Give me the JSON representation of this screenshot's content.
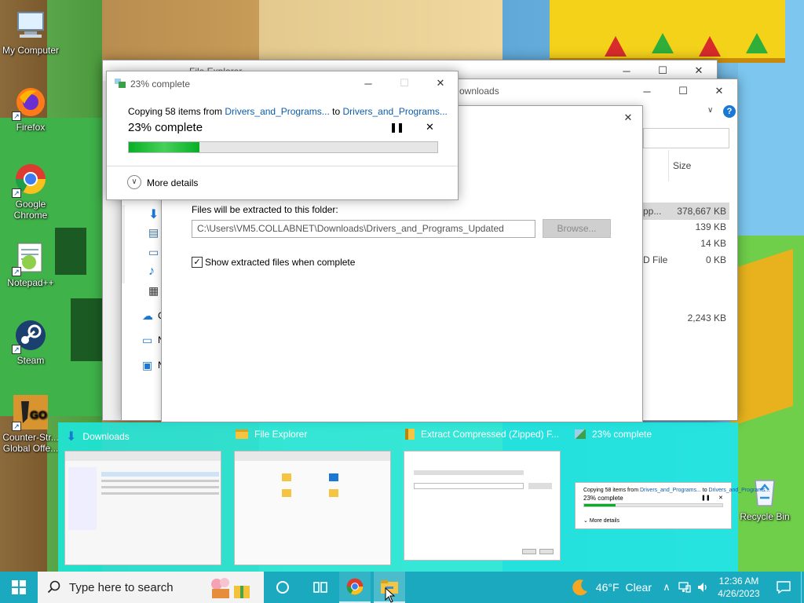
{
  "desktop": {
    "icons": [
      {
        "label": "My Computer",
        "icon": "computer-icon"
      },
      {
        "label": "Firefox",
        "icon": "firefox-icon"
      },
      {
        "label": "Google Chrome",
        "icon": "chrome-icon"
      },
      {
        "label": "Notepad++",
        "icon": "notepad-plus-icon"
      },
      {
        "label": "Steam",
        "icon": "steam-icon"
      },
      {
        "label": "Counter-Str... Global Offe...",
        "icon": "csgo-icon"
      },
      {
        "label": "Recycle Bin",
        "icon": "recycle-bin-icon"
      }
    ]
  },
  "file_explorer_back": {
    "title": "File Explorer"
  },
  "downloads_window": {
    "title_fragment": "ownloads",
    "column_size": "Size",
    "rows": [
      {
        "type": "pp...",
        "size": "378,667 KB"
      },
      {
        "type": "",
        "size": "139 KB"
      },
      {
        "type": "",
        "size": "14 KB"
      },
      {
        "type": "D File",
        "size": "0 KB"
      },
      {
        "type": "",
        "size": "2,243 KB"
      }
    ],
    "nav_letters": [
      "C",
      "N",
      "N"
    ]
  },
  "extract_dialog": {
    "dest_label": "Files will be extracted to this folder:",
    "dest_path": "C:\\Users\\VM5.COLLABNET\\Downloads\\Drivers_and_Programs_Updated",
    "browse_label": "Browse...",
    "checkbox_label": "Show extracted files when complete",
    "checkbox_checked": true
  },
  "progress_dialog": {
    "title": "23% complete",
    "copying_prefix": "Copying 58 items from",
    "source": "Drivers_and_Programs...",
    "to_word": "to",
    "dest": "Drivers_and_Programs...",
    "status": "23% complete",
    "progress_fraction": 0.23,
    "more_details": "More details"
  },
  "preview": {
    "items": [
      {
        "title": "Downloads",
        "icon": "downloads-folder-icon"
      },
      {
        "title": "File Explorer",
        "icon": "file-explorer-icon"
      },
      {
        "title": "Extract Compressed (Zipped) F...",
        "icon": "zip-folder-icon"
      },
      {
        "title": "23% complete",
        "icon": "copy-progress-icon"
      }
    ],
    "mini_progress": {
      "copying": "Copying 58 items from",
      "src": "Drivers_and_Programs...",
      "to": "to",
      "dst": "Drivers_and_Programs...",
      "status": "23% complete",
      "more": "More details"
    }
  },
  "taskbar": {
    "search_placeholder": "Type here to search",
    "weather_temp": "46°F",
    "weather_desc": "Clear",
    "time": "12:36 AM",
    "date": "4/26/2023"
  },
  "colors": {
    "taskbar": "#1aa9bf",
    "link_blue": "#0b5cad",
    "progress_green": "#06b025",
    "preview_cyan": "#1ce8de"
  }
}
